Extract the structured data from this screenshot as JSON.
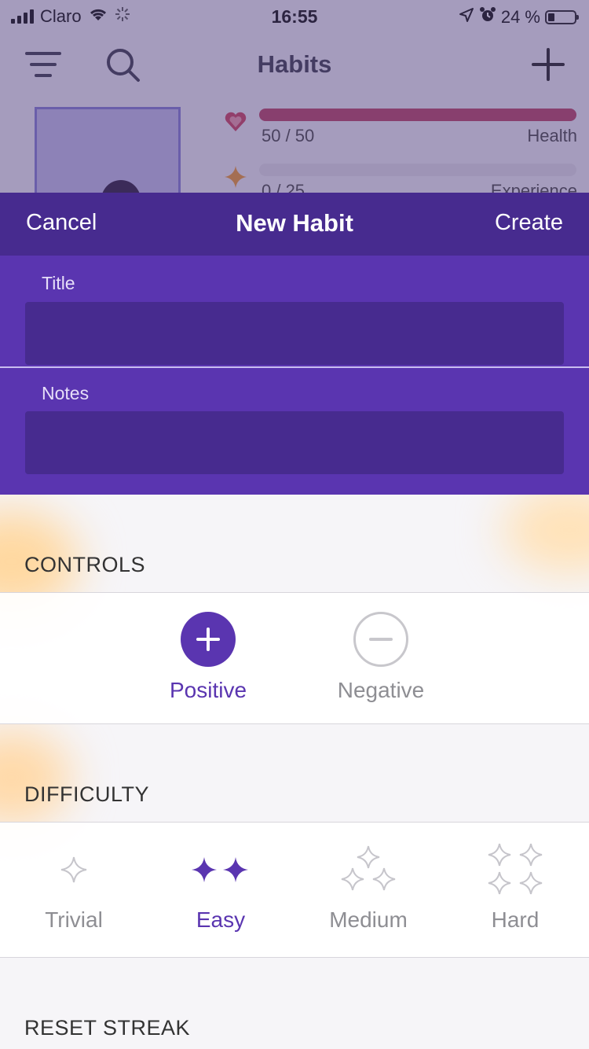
{
  "status_bar": {
    "carrier": "Claro",
    "time": "16:55",
    "battery": "24 %"
  },
  "background_app": {
    "title": "Habits",
    "health": {
      "value": "50 / 50",
      "label": "Health",
      "fill": 1.0
    },
    "experience": {
      "value": "0 / 25",
      "label": "Experience",
      "fill": 0.0
    }
  },
  "modal": {
    "cancel_label": "Cancel",
    "title": "New Habit",
    "create_label": "Create",
    "title_field": {
      "label": "Title",
      "value": ""
    },
    "notes_field": {
      "label": "Notes",
      "value": ""
    }
  },
  "controls": {
    "section_title": "CONTROLS",
    "positive_label": "Positive",
    "negative_label": "Negative",
    "selected": "Positive"
  },
  "difficulty": {
    "section_title": "DIFFICULTY",
    "options": [
      "Trivial",
      "Easy",
      "Medium",
      "Hard"
    ],
    "selected": "Easy"
  },
  "reset_streak": {
    "section_title": "RESET STREAK"
  },
  "colors": {
    "accent": "#5a35b0",
    "header": "#472b8f",
    "health_bar": "#c0506f",
    "muted": "#8e8e93"
  }
}
